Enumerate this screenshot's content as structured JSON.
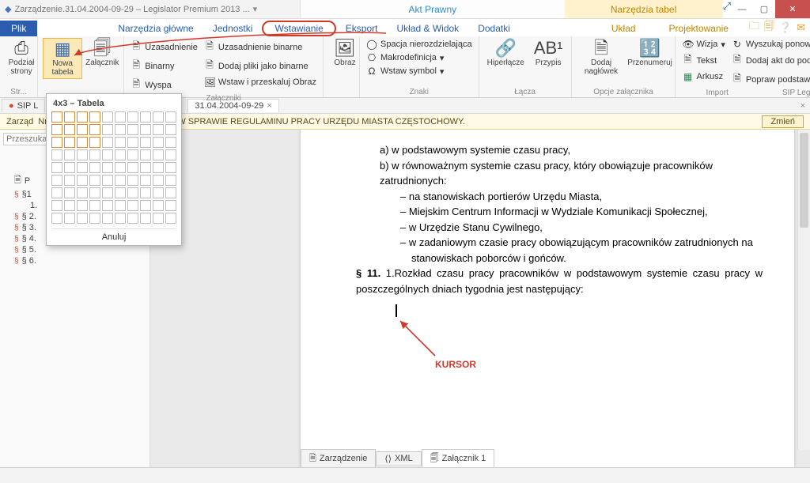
{
  "title_left": "Zarządzenie.31.04.2004-09-29 – Legislator Premium 2013 ...",
  "title_mid": "Akt Prawny",
  "title_right": "Narzędzia tabel",
  "file_tab": "Plik",
  "tabs": [
    "Narzędzia główne",
    "Jednostki",
    "Wstawianie",
    "Eksport",
    "Układ & Widok",
    "Dodatki"
  ],
  "tabs_right": [
    "Układ",
    "Projektowanie"
  ],
  "ribbon": {
    "g1": {
      "podzial": "Podział strony",
      "label": "Str..."
    },
    "g2": {
      "nowa_tabela": "Nowa tabela",
      "zalacznik": "Załącznik"
    },
    "g3": {
      "uzasadnienie": "Uzasadnienie",
      "binarny": "Binarny",
      "wyspa": "Wyspa",
      "uzasadnienie_bin": "Uzasadnienie binarne",
      "dodaj_pliki": "Dodaj pliki jako binarne",
      "wstaw_obraz": "Wstaw i przeskaluj Obraz",
      "label": "Załączniki"
    },
    "g4": {
      "obraz": "Obraz"
    },
    "g5": {
      "spacja": "Spacja nierozdzielająca",
      "makro": "Makrodefinicja",
      "symbol": "Wstaw symbol",
      "label": "Znaki"
    },
    "g6": {
      "hiperlacze": "Hiperłącze",
      "przypis": "Przypis",
      "label": "Łącza"
    },
    "g7": {
      "dodaj_naglowek": "Dodaj nagłówek",
      "przenumeruj": "Przenumeruj",
      "label": "Opcje załącznika"
    },
    "g8": {
      "import": "Import",
      "label": "Import"
    },
    "g9": {
      "wizja": "Wizja",
      "tekst": "Tekst",
      "arkusz": "Arkusz",
      "wyszukaj": "Wyszukaj ponownie",
      "dodaj_akt": "Dodaj akt do podstawy...",
      "popraw": "Popraw podstawę prawną",
      "label": "SIP Legalis"
    }
  },
  "sub_tab_left": "SIP L",
  "sub_tab_main": "31.04.2004-09-29",
  "info_bar": "Nr 31/04 z dnia 29 września 2004 r. W SPRAWIE REGULAMINU PRACY URZĘDU MIASTA CZĘSTOCHOWY.",
  "info_prefix": "Zarząd",
  "info_btn": "Zmień",
  "sidebar": {
    "search_ph": "Przeszuka",
    "root": "P",
    "sect": "§1",
    "items": [
      "1.",
      "§ 2.",
      "§ 3.",
      "§ 4.",
      "§ 5.",
      "§ 6."
    ]
  },
  "doc": {
    "la": "a)   w podstawowym systemie czasu pracy,",
    "lb": "b)   w równoważnym systemie czasu pracy, który obowiązuje pracowników zatrudnionych:",
    "d1": "–   na stanowiskach portierów Urzędu Miasta,",
    "d2": "–   Miejskim Centrum Informacji w Wydziale Komunikacji Społecznej,",
    "d3": "–   w Urzędzie Stanu Cywilnego,",
    "d4": "–   w zadaniowym czasie pracy obowiązującym pracowników zatrudnionych na stanowiskach poborców i gońców.",
    "p11a": "§ 11.",
    "p11b": "1.Rozkład czasu pracy pracowników w podstawowym systemie czasu pracy w poszczególnych dniach tygodnia jest następujący:",
    "kursor": "KURSOR"
  },
  "popup": {
    "title": "4x3 – Tabela",
    "cancel": "Anuluj",
    "rows": 3,
    "cols": 4
  },
  "doc_tabs": [
    "Zarządzenie",
    "XML",
    "Załącznik 1"
  ]
}
